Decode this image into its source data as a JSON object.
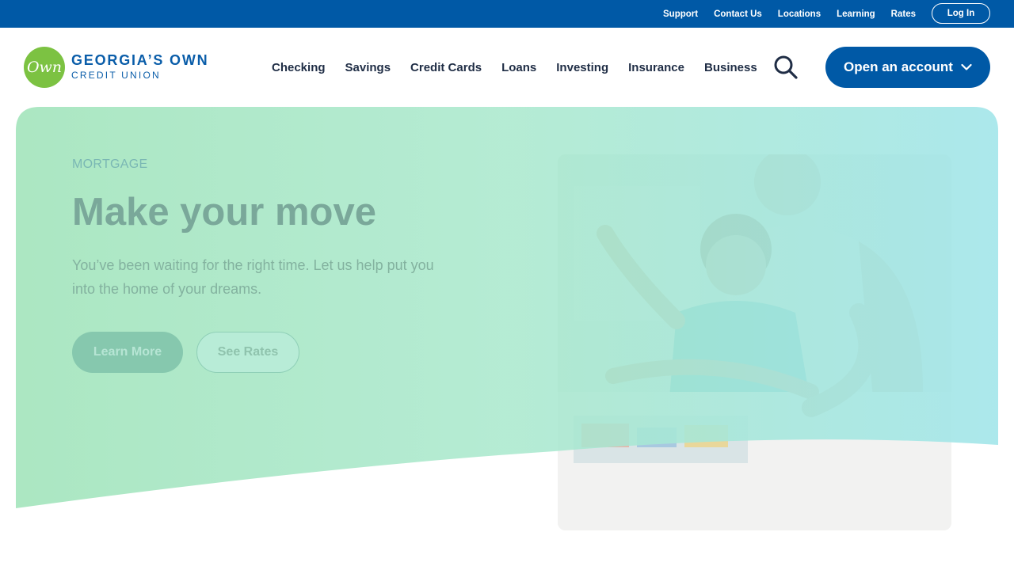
{
  "utility_nav": {
    "links": [
      {
        "label": "Support"
      },
      {
        "label": "Contact Us"
      },
      {
        "label": "Locations"
      },
      {
        "label": "Learning"
      },
      {
        "label": "Rates"
      }
    ],
    "login_label": "Log In"
  },
  "brand": {
    "logo_mark": "Own",
    "name_line1": "GEORGIA’S OWN",
    "name_line2": "CREDIT UNION"
  },
  "main_nav": {
    "items": [
      {
        "label": "Checking"
      },
      {
        "label": "Savings"
      },
      {
        "label": "Credit Cards"
      },
      {
        "label": "Loans"
      },
      {
        "label": "Investing"
      },
      {
        "label": "Insurance"
      },
      {
        "label": "Business"
      }
    ],
    "search_icon": "search-icon",
    "cta_label": "Open an account",
    "cta_icon": "chevron-down-icon"
  },
  "hero": {
    "eyebrow": "MORTGAGE",
    "title": "Make your move",
    "subtitle": "You’ve been waiting for the right time. Let us help put you into the home of your dreams.",
    "primary_button": "Learn More",
    "secondary_button": "See Rates"
  },
  "colors": {
    "brand_blue": "#0059a6",
    "logo_green": "#7cc242",
    "hero_gradient_start": "#a8e6c0",
    "hero_gradient_end": "#a6e6e6",
    "nav_text": "#1f2d45"
  }
}
